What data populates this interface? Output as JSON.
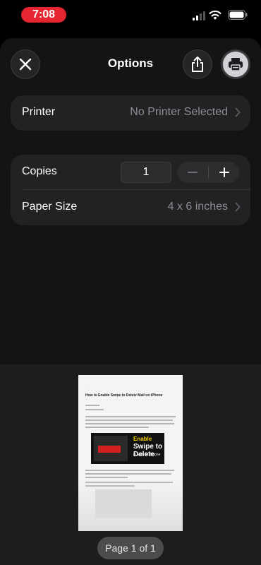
{
  "status_bar": {
    "time": "7:08"
  },
  "header": {
    "title": "Options"
  },
  "printer": {
    "label": "Printer",
    "value": "No Printer Selected"
  },
  "copies": {
    "label": "Copies",
    "value": "1"
  },
  "paper_size": {
    "label": "Paper Size",
    "value": "4 x 6 inches"
  },
  "preview": {
    "page_indicator": "Page 1 of 1",
    "doc_title": "How to Enable Swipe to Delete Mail on iPhone",
    "doc_image_text": {
      "line1": "Enable",
      "line2": "Swipe to Delete",
      "line3": "in Mail on iPhone"
    }
  },
  "colors": {
    "time_pill": "#e5252f",
    "sheet_bg": "#141414",
    "card_bg": "#222224",
    "secondary_text": "#8e8e93"
  },
  "icons": [
    "close-icon",
    "share-icon",
    "print-icon",
    "chevron-right-icon",
    "minus-icon",
    "plus-icon"
  ]
}
